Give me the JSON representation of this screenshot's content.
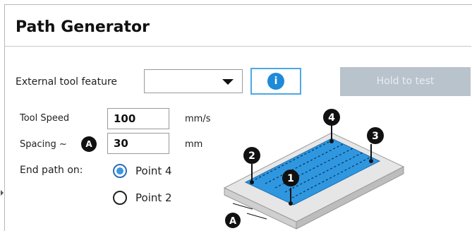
{
  "title": "Path Generator",
  "external_tool": {
    "label": "External tool feature",
    "selected_value": "",
    "info_label": "i"
  },
  "hold_button": {
    "label": "Hold to test",
    "enabled": false
  },
  "tool_speed": {
    "label": "Tool Speed",
    "value": "100",
    "unit": "mm/s"
  },
  "spacing": {
    "label": "Spacing ~",
    "badge": "A",
    "value": "30",
    "unit": "mm"
  },
  "end_path": {
    "label": "End path on:",
    "options": [
      {
        "label": "Point 4",
        "selected": true
      },
      {
        "label": "Point 2",
        "selected": false
      }
    ]
  },
  "diagram": {
    "markers": [
      "1",
      "2",
      "3",
      "4"
    ],
    "spacing_badge": "A"
  },
  "colors": {
    "accent": "#1e8ad8",
    "disabled_button": "#b9c3cc",
    "plate_blue": "#2f97e0"
  }
}
